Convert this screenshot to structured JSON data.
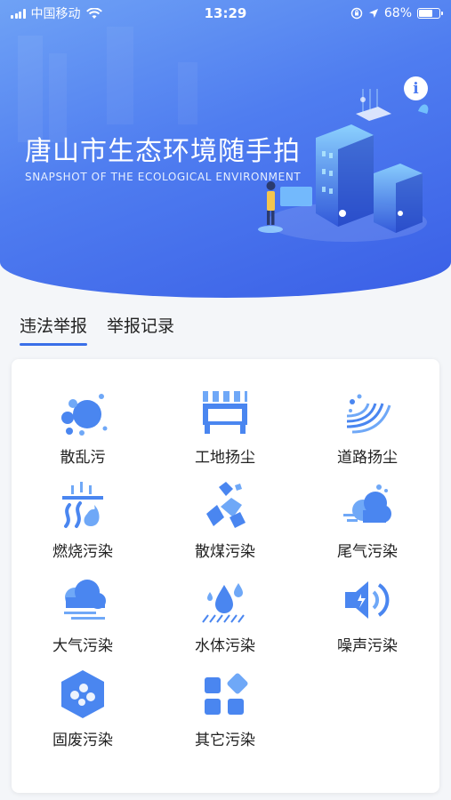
{
  "status_bar": {
    "carrier": "中国移动",
    "time": "13:29",
    "battery": "68%",
    "battery_level": 0.68,
    "icons": [
      "signal-icon",
      "wifi-icon",
      "orientation-lock-icon",
      "location-icon",
      "battery-icon"
    ]
  },
  "header": {
    "title": "唐山市生态环境随手拍",
    "subtitle": "SNAPSHOT OF THE ECOLOGICAL ENVIRONMENT",
    "info_icon": "info-icon"
  },
  "tabs": [
    {
      "label": "违法举报",
      "active": true
    },
    {
      "label": "举报记录",
      "active": false
    }
  ],
  "categories": [
    {
      "label": "散乱污",
      "icon": "scattered-pollution-icon"
    },
    {
      "label": "工地扬尘",
      "icon": "construction-dust-icon"
    },
    {
      "label": "道路扬尘",
      "icon": "road-dust-icon"
    },
    {
      "label": "燃烧污染",
      "icon": "burning-pollution-icon"
    },
    {
      "label": "散煤污染",
      "icon": "coal-pollution-icon"
    },
    {
      "label": "尾气污染",
      "icon": "exhaust-pollution-icon"
    },
    {
      "label": "大气污染",
      "icon": "air-pollution-icon"
    },
    {
      "label": "水体污染",
      "icon": "water-pollution-icon"
    },
    {
      "label": "噪声污染",
      "icon": "noise-pollution-icon"
    },
    {
      "label": "固废污染",
      "icon": "solid-waste-icon"
    },
    {
      "label": "其它污染",
      "icon": "other-pollution-icon"
    }
  ],
  "colors": {
    "accent": "#3a6fe8",
    "hero_start": "#6fa2f5",
    "hero_end": "#3a5fe6",
    "icon_blue": "#4a86f0"
  }
}
